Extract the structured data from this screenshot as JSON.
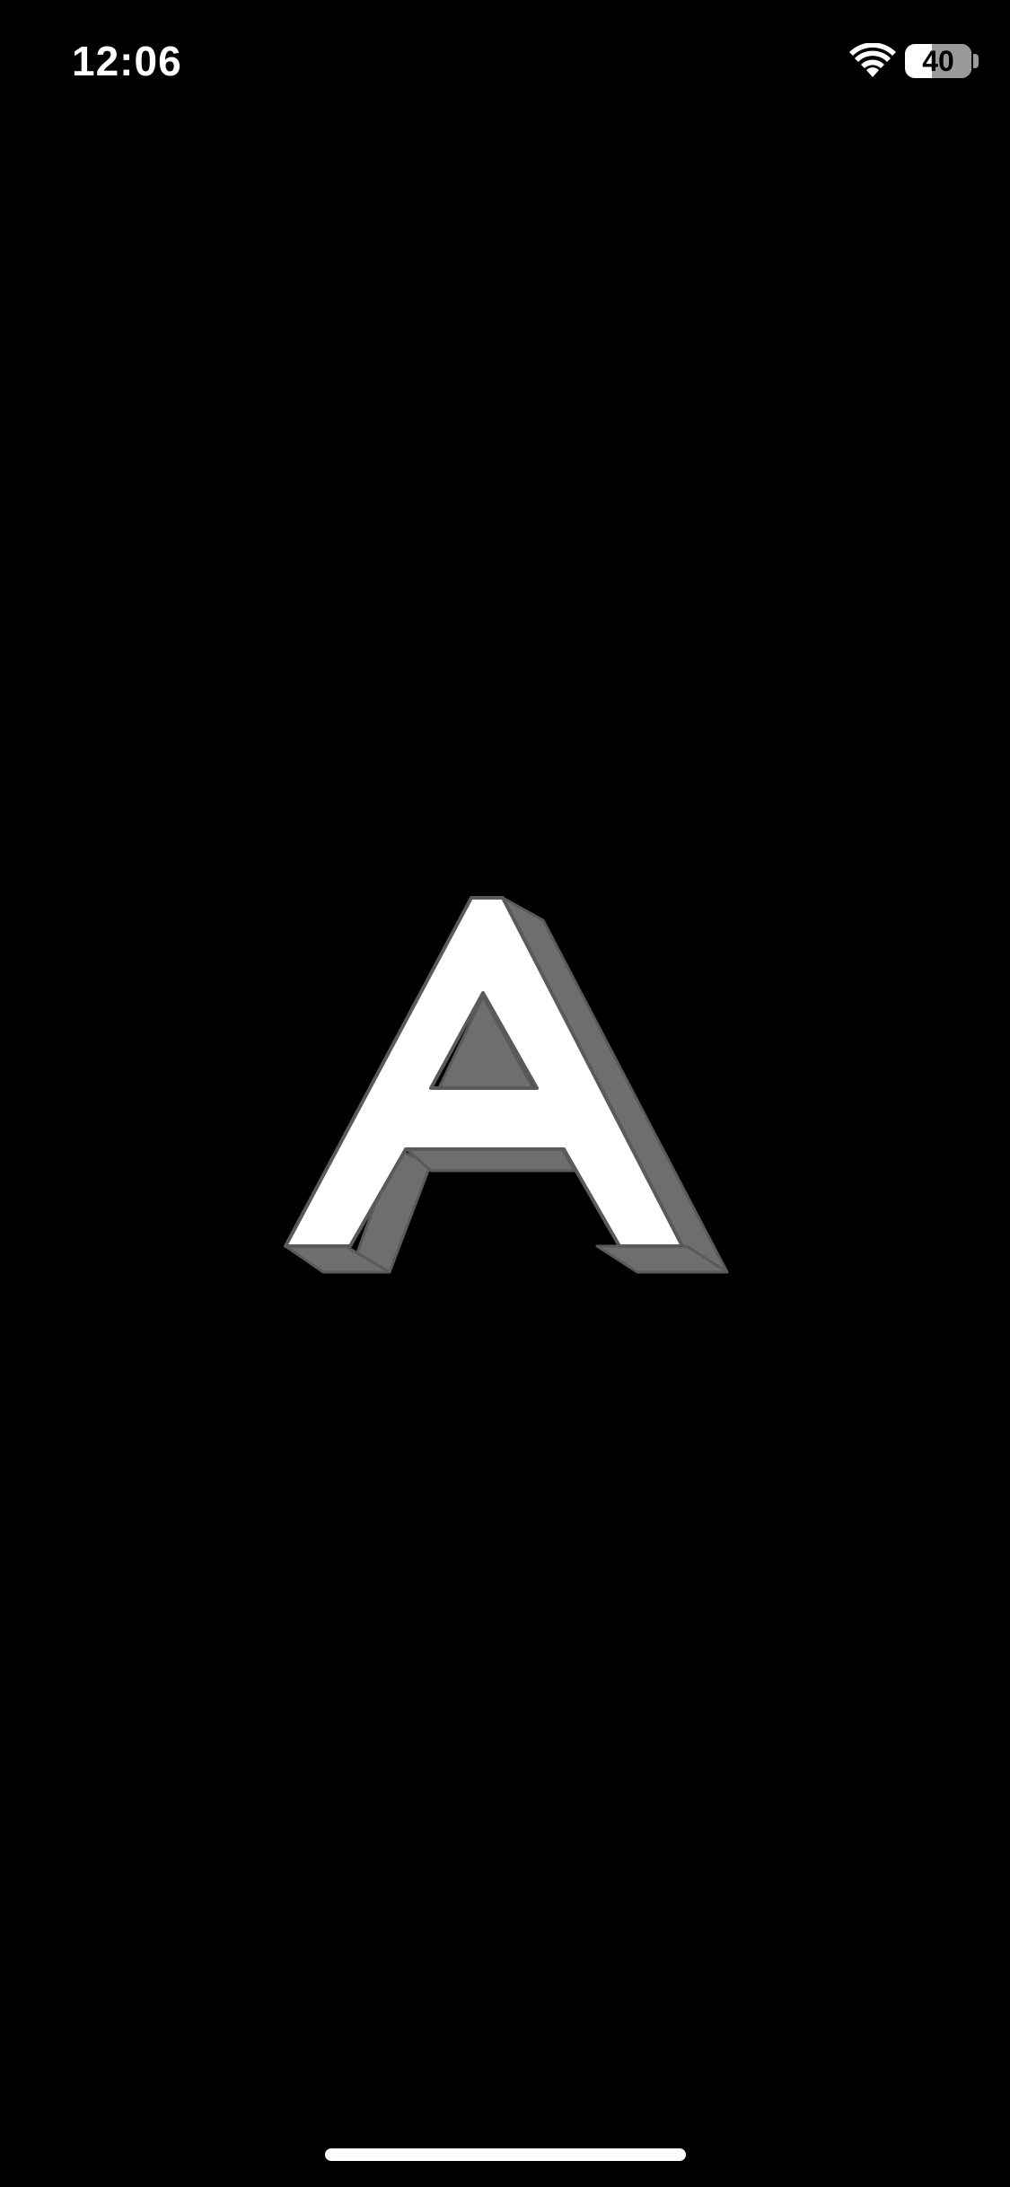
{
  "status_bar": {
    "time": "12:06",
    "battery_level": "40",
    "battery_fraction": 0.4,
    "wifi_icon": "wifi-icon",
    "battery_icon": "battery-icon"
  },
  "splash": {
    "logo_icon": "letter-a-3d-logo",
    "logo_colors": {
      "face": "#ffffff",
      "side": "#6e6e6e",
      "outline": "#5a5a5a"
    }
  },
  "colors": {
    "background": "#000000",
    "home_indicator": "#ffffff"
  }
}
